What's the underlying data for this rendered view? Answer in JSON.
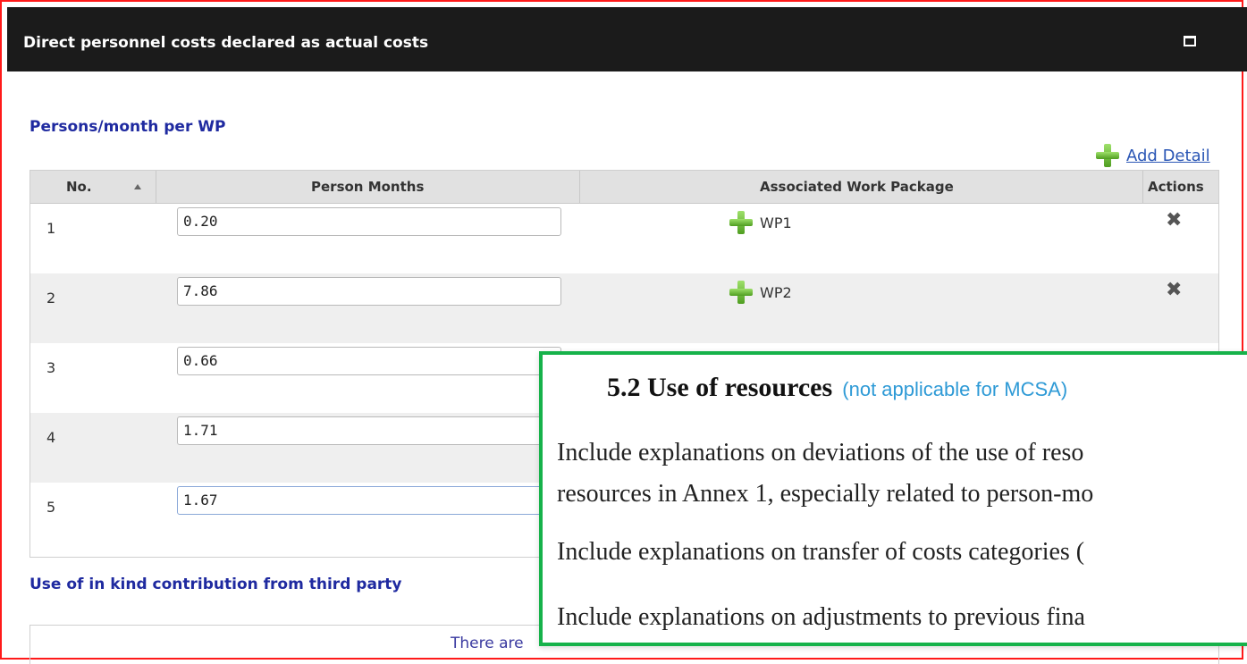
{
  "window": {
    "title": "Direct personnel costs declared as actual costs"
  },
  "sections": {
    "persons_per_wp": "Persons/month per WP",
    "in_kind": "Use of in kind contribution from third party"
  },
  "toolbar": {
    "add_detail_label": "Add Detail"
  },
  "table": {
    "headers": {
      "no": "No.",
      "person_months": "Person Months",
      "work_package": "Associated Work Package",
      "actions": "Actions"
    },
    "rows": [
      {
        "no": "1",
        "person_months": "0.20",
        "work_package": "WP1"
      },
      {
        "no": "2",
        "person_months": "7.86",
        "work_package": "WP2"
      },
      {
        "no": "3",
        "person_months": "0.66",
        "work_package": ""
      },
      {
        "no": "4",
        "person_months": "1.71",
        "work_package": ""
      },
      {
        "no": "5",
        "person_months": "1.67",
        "work_package": ""
      }
    ]
  },
  "in_kind_empty_text": "There are",
  "overlay": {
    "heading": "5.2 Use of resources",
    "heading_note": "(not applicable for MCSA)",
    "lines": [
      "Include explanations on deviations of the use of reso",
      "resources in Annex 1, especially related to person-mo",
      "Include explanations on transfer of costs categories (",
      "Include explanations on adjustments to previous fina"
    ]
  },
  "colors": {
    "title_bar": "#1b1b1b",
    "section_title": "#1f2aa0",
    "link": "#2a56b5",
    "frame_red": "#ff1a1a",
    "overlay_green": "#16b24a",
    "note_blue": "#2e9ad6"
  }
}
